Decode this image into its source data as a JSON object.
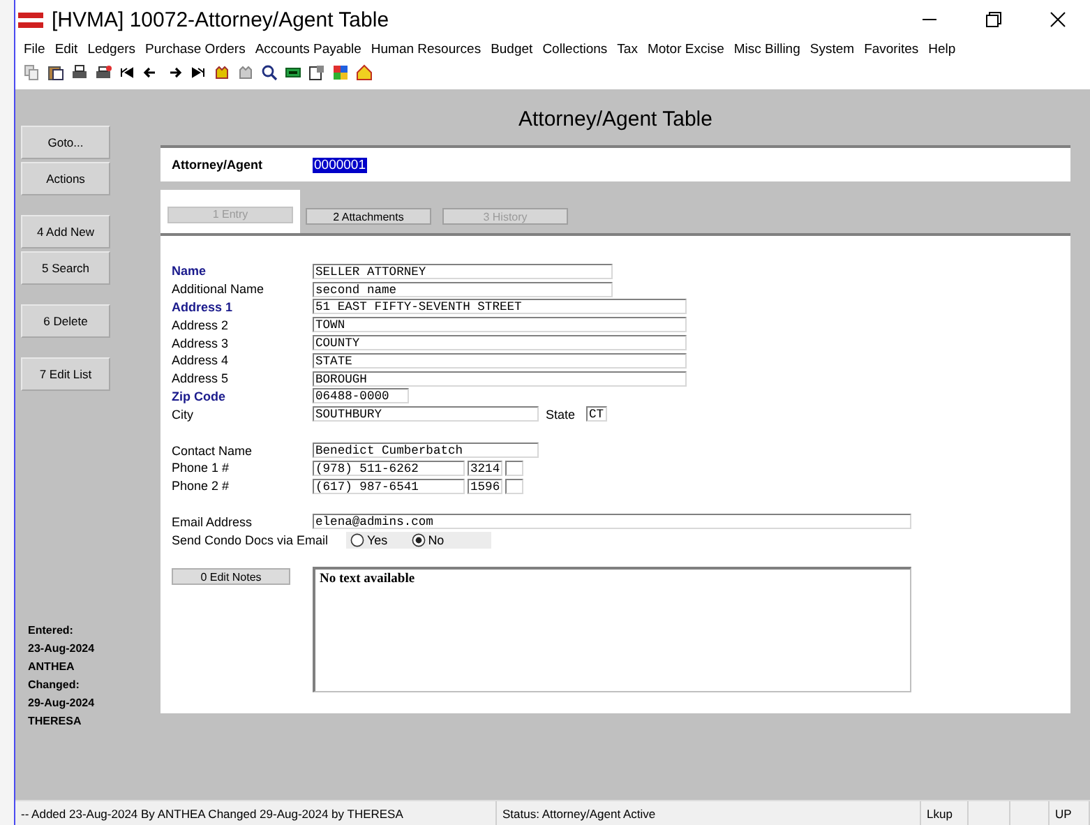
{
  "window": {
    "title": "[HVMA] 10072-Attorney/Agent Table"
  },
  "menu": [
    "File",
    "Edit",
    "Ledgers",
    "Purchase Orders",
    "Accounts Payable",
    "Human Resources",
    "Budget",
    "Collections",
    "Tax",
    "Motor Excise",
    "Misc Billing",
    "System",
    "Favorites",
    "Help"
  ],
  "sidebar": {
    "groups": [
      [
        "Goto...",
        "Actions"
      ],
      [
        "4 Add New",
        "5 Search"
      ],
      [
        "6 Delete"
      ],
      [
        "7 Edit List"
      ]
    ],
    "meta": [
      "Entered:",
      "23-Aug-2024",
      "ANTHEA",
      "Changed:",
      "29-Aug-2024",
      "THERESA"
    ]
  },
  "page_title": "Attorney/Agent Table",
  "key": {
    "label": "Attorney/Agent",
    "value": "0000001"
  },
  "tabs": [
    {
      "label": "1 Entry",
      "selected": true,
      "disabled": false
    },
    {
      "label": "2 Attachments",
      "selected": false,
      "disabled": false
    },
    {
      "label": "3 History",
      "selected": false,
      "disabled": true
    }
  ],
  "fields": [
    {
      "label": "Name",
      "value": "SELLER ATTORNEY",
      "required": true,
      "kind": "medium"
    },
    {
      "label": "Additional Name",
      "value": "second name",
      "required": false,
      "kind": "medium"
    },
    {
      "label": "Address 1",
      "value": "51 EAST FIFTY-SEVENTH STREET",
      "required": true,
      "kind": "long"
    },
    {
      "label": "Address 2",
      "value": "TOWN",
      "required": false,
      "kind": "long"
    },
    {
      "label": "Address 3",
      "value": "COUNTY",
      "required": false,
      "kind": "long"
    },
    {
      "label": "Address 4",
      "value": "STATE",
      "required": false,
      "kind": "long"
    },
    {
      "label": "Address 5",
      "value": "BOROUGH",
      "required": false,
      "kind": "long"
    },
    {
      "label": "Zip Code",
      "value": "06488-0000",
      "required": true,
      "kind": "short"
    }
  ],
  "city": {
    "label": "City",
    "value": "SOUTHBURY",
    "state_label": "State",
    "state_value": "CT"
  },
  "contact": {
    "label": "Contact Name",
    "value": "Benedict Cumberbatch"
  },
  "phones": [
    {
      "label": "Phone 1 #",
      "number": "(978) 511-6262",
      "ext": "3214"
    },
    {
      "label": "Phone 2 #",
      "number": "(617) 987-6541",
      "ext": "1596"
    }
  ],
  "email": {
    "label": "Email Address",
    "value": "elena@admins.com"
  },
  "condo_docs": {
    "label": "Send Condo Docs via Email",
    "options": [
      {
        "label": "Yes",
        "selected": false
      },
      {
        "label": "No",
        "selected": true
      }
    ]
  },
  "notes": {
    "button": "0 Edit Notes",
    "text": "No text available"
  },
  "status_bar": {
    "message": "-- Added 23-Aug-2024 By ANTHEA Changed 29-Aug-2024 by THERESA",
    "status": "Status: Attorney/Agent Active",
    "mode": "Lkup",
    "flag": "UP"
  }
}
